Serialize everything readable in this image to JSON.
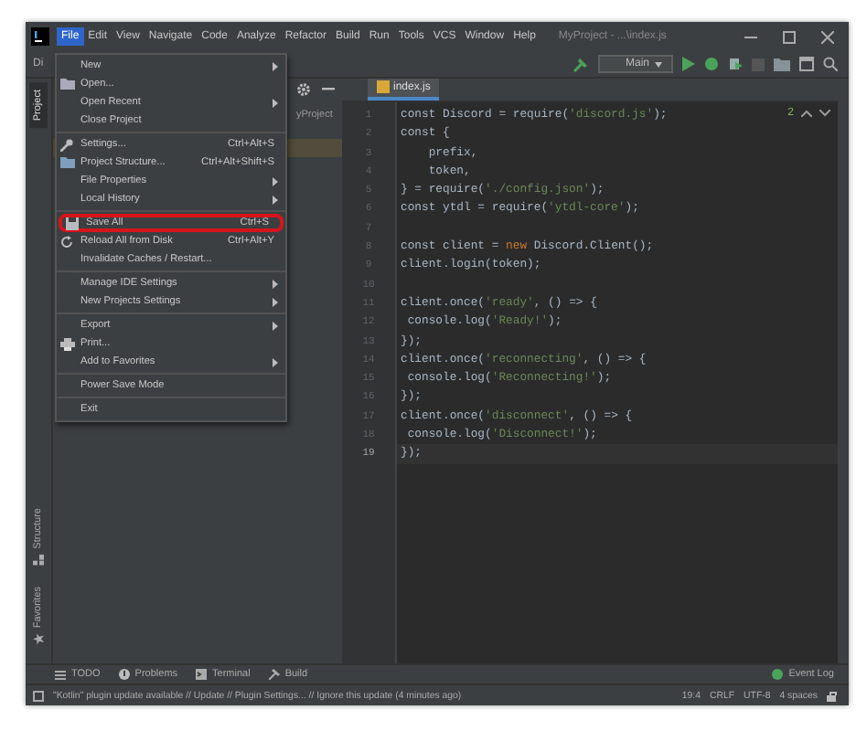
{
  "window": {
    "title": "MyProject - ...\\index.js"
  },
  "menu_bar": [
    {
      "label": "File",
      "selected": true
    },
    {
      "label": "Edit",
      "selected": false
    },
    {
      "label": "View",
      "selected": false
    },
    {
      "label": "Navigate",
      "selected": false
    },
    {
      "label": "Code",
      "selected": false
    },
    {
      "label": "Analyze",
      "selected": false
    },
    {
      "label": "Refactor",
      "selected": false
    },
    {
      "label": "Build",
      "selected": false
    },
    {
      "label": "Run",
      "selected": false
    },
    {
      "label": "Tools",
      "selected": false
    },
    {
      "label": "VCS",
      "selected": false
    },
    {
      "label": "Window",
      "selected": false
    },
    {
      "label": "Help",
      "selected": false
    }
  ],
  "breadcrumb": "Di",
  "toolbar": {
    "run_configuration": "Main"
  },
  "left_tool_tabs": [
    {
      "label": "Project",
      "selected": true
    }
  ],
  "left_bottom_tabs": [
    {
      "label": "Structure",
      "kind": "structure",
      "selected": false
    },
    {
      "label": "Favorites",
      "kind": "favorites",
      "selected": false
    }
  ],
  "project_panel": {
    "root": "yProject"
  },
  "file_menu": {
    "groups": [
      [
        {
          "label": "New",
          "kind": "plain",
          "submenu": true,
          "highlighted": false
        },
        {
          "label": "Open...",
          "kind": "open",
          "submenu": false,
          "highlighted": false
        },
        {
          "label": "Open Recent",
          "kind": "plain",
          "submenu": true,
          "highlighted": false
        },
        {
          "label": "Close Project",
          "kind": "plain",
          "submenu": false,
          "highlighted": false
        }
      ],
      [
        {
          "label": "Settings...",
          "kind": "settings",
          "shortcut": "Ctrl+Alt+S",
          "submenu": false,
          "highlighted": false
        },
        {
          "label": "Project Structure...",
          "kind": "structure",
          "shortcut": "Ctrl+Alt+Shift+S",
          "submenu": false,
          "highlighted": false
        },
        {
          "label": "File Properties",
          "kind": "plain",
          "submenu": true,
          "highlighted": false
        },
        {
          "label": "Local History",
          "kind": "plain",
          "submenu": true,
          "highlighted": false
        }
      ],
      [
        {
          "label": "Save All",
          "kind": "save",
          "shortcut": "Ctrl+S",
          "submenu": false,
          "highlighted": true
        },
        {
          "label": "Reload All from Disk",
          "kind": "reload",
          "shortcut": "Ctrl+Alt+Y",
          "submenu": false,
          "highlighted": false
        },
        {
          "label": "Invalidate Caches / Restart...",
          "kind": "plain",
          "submenu": false,
          "highlighted": false
        }
      ],
      [
        {
          "label": "Manage IDE Settings",
          "kind": "plain",
          "submenu": true,
          "highlighted": false
        },
        {
          "label": "New Projects Settings",
          "kind": "plain",
          "submenu": true,
          "highlighted": false
        }
      ],
      [
        {
          "label": "Export",
          "kind": "plain",
          "submenu": true,
          "highlighted": false
        },
        {
          "label": "Print...",
          "kind": "print",
          "submenu": false,
          "highlighted": false
        },
        {
          "label": "Add to Favorites",
          "kind": "plain",
          "submenu": true,
          "highlighted": false
        }
      ],
      [
        {
          "label": "Power Save Mode",
          "kind": "plain",
          "submenu": false,
          "highlighted": false
        }
      ],
      [
        {
          "label": "Exit",
          "kind": "plain",
          "submenu": false,
          "highlighted": false
        }
      ]
    ]
  },
  "editor": {
    "tab": {
      "label": "index.js",
      "selected": true
    },
    "inspections": "2",
    "lines": [
      {
        "number": "1",
        "current": false,
        "tokens": [
          {
            "kind": "plain",
            "text": "const Discord = require("
          },
          {
            "kind": "string",
            "text": "'discord.js'"
          },
          {
            "kind": "plain",
            "text": ");"
          }
        ]
      },
      {
        "number": "2",
        "current": false,
        "tokens": [
          {
            "kind": "plain",
            "text": "const {"
          }
        ]
      },
      {
        "number": "3",
        "current": false,
        "tokens": [
          {
            "kind": "plain",
            "text": "    prefix,"
          }
        ]
      },
      {
        "number": "4",
        "current": false,
        "tokens": [
          {
            "kind": "plain",
            "text": "    token,"
          }
        ]
      },
      {
        "number": "5",
        "current": false,
        "tokens": [
          {
            "kind": "plain",
            "text": "} = require("
          },
          {
            "kind": "string",
            "text": "'./config.json'"
          },
          {
            "kind": "plain",
            "text": ");"
          }
        ]
      },
      {
        "number": "6",
        "current": false,
        "tokens": [
          {
            "kind": "plain",
            "text": "const ytdl = require("
          },
          {
            "kind": "string",
            "text": "'ytdl-core'"
          },
          {
            "kind": "plain",
            "text": ");"
          }
        ]
      },
      {
        "number": "7",
        "current": false
      },
      {
        "number": "8",
        "current": false,
        "tokens": [
          {
            "kind": "plain",
            "text": "const client = "
          },
          {
            "kind": "keyword",
            "text": "new"
          },
          {
            "kind": "plain",
            "text": " Discord.Client();"
          }
        ]
      },
      {
        "number": "9",
        "current": false,
        "tokens": [
          {
            "kind": "plain",
            "text": "client.login(token);"
          }
        ]
      },
      {
        "number": "10",
        "current": false
      },
      {
        "number": "11",
        "current": false,
        "tokens": [
          {
            "kind": "plain",
            "text": "client.once("
          },
          {
            "kind": "string",
            "text": "'ready'"
          },
          {
            "kind": "plain",
            "text": ", () => {"
          }
        ]
      },
      {
        "number": "12",
        "current": false,
        "tokens": [
          {
            "kind": "plain",
            "text": " console.log("
          },
          {
            "kind": "string",
            "text": "'Ready!'"
          },
          {
            "kind": "plain",
            "text": ");"
          }
        ]
      },
      {
        "number": "13",
        "current": false,
        "tokens": [
          {
            "kind": "plain",
            "text": "});"
          }
        ]
      },
      {
        "number": "14",
        "current": false,
        "tokens": [
          {
            "kind": "plain",
            "text": "client.once("
          },
          {
            "kind": "string",
            "text": "'reconnecting'"
          },
          {
            "kind": "plain",
            "text": ", () => {"
          }
        ]
      },
      {
        "number": "15",
        "current": false,
        "tokens": [
          {
            "kind": "plain",
            "text": " console.log("
          },
          {
            "kind": "string",
            "text": "'Reconnecting!'"
          },
          {
            "kind": "plain",
            "text": ");"
          }
        ]
      },
      {
        "number": "16",
        "current": false,
        "tokens": [
          {
            "kind": "plain",
            "text": "});"
          }
        ]
      },
      {
        "number": "17",
        "current": false,
        "tokens": [
          {
            "kind": "plain",
            "text": "client.once("
          },
          {
            "kind": "string",
            "text": "'disconnect'"
          },
          {
            "kind": "plain",
            "text": ", () => {"
          }
        ]
      },
      {
        "number": "18",
        "current": false,
        "tokens": [
          {
            "kind": "plain",
            "text": " console.log("
          },
          {
            "kind": "string",
            "text": "'Disconnect!'"
          },
          {
            "kind": "plain",
            "text": ");"
          }
        ]
      },
      {
        "number": "19",
        "current": true,
        "tokens": [
          {
            "kind": "plain",
            "text": "});"
          }
        ]
      }
    ]
  },
  "tool_windows": [
    {
      "label": "TODO",
      "kind": "todo"
    },
    {
      "label": "Problems",
      "kind": "problems"
    },
    {
      "label": "Terminal",
      "kind": "terminal"
    },
    {
      "label": "Build",
      "kind": "build"
    }
  ],
  "event_log": "Event Log",
  "status_bar": {
    "message": "\"Kotlin\" plugin update available // Update // Plugin Settings... // Ignore this update (4 minutes ago)",
    "position": "19:4",
    "line_separator": "CRLF",
    "encoding": "UTF-8",
    "indent": "4 spaces"
  }
}
